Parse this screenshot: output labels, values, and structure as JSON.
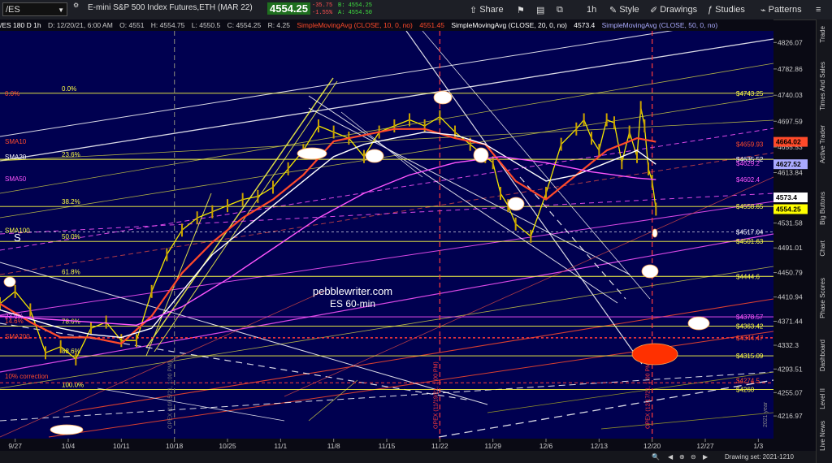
{
  "toolbar": {
    "symbol": "/ES",
    "title": "E-mini S&P 500 Index Futures,ETH (MAR 22)",
    "last_price": "4554.25",
    "change": "-35.75",
    "change_pct": "-1.55%",
    "bid": "B: 4554.25",
    "ask": "A: 4554.50",
    "share": "Share",
    "timeframe": "1h",
    "style": "Style",
    "drawings": "Drawings",
    "studies": "Studies",
    "patterns": "Patterns"
  },
  "info_bar": {
    "chart_id": "/ES 180 D 1h",
    "date": "D: 12/20/21, 6:00 AM",
    "open": "O: 4551",
    "high": "H: 4554.75",
    "low": "L: 4550.5",
    "close": "C: 4554.25",
    "range": "R: 4.25",
    "sma10": "SimpleMovingAvg (CLOSE, 10, 0, no)",
    "sma10_val": "4551.45",
    "sma20": "SimpleMovingAvg (CLOSE, 20, 0, no)",
    "sma20_val": "4573.4",
    "sma50": "SimpleMovingAvg (CLOSE, 50, 0, no)"
  },
  "sidebar": [
    "Trade",
    "Times And Sales",
    "Active Trader",
    "Big Buttons",
    "Chart",
    "Phase Scores",
    "Dashboard",
    "Level II",
    "Live News"
  ],
  "status": {
    "drawing_set": "Drawing set: 2021-1210"
  },
  "colors": {
    "background": "#000050",
    "sma10": "#ff4a2a",
    "sma20": "#ffffff",
    "sma50": "#ff55ff",
    "fib": "#ffff44",
    "opex": "#ff3a3a",
    "price_up": "#f2e600",
    "price_down": "#c8a000"
  },
  "chart_data": {
    "type": "line",
    "ylim": [
      4180,
      4845
    ],
    "y_ticks": [
      4826.07,
      4782.86,
      4740.03,
      4697.59,
      4655.53,
      4613.84,
      4572.6,
      4531.58,
      4491.01,
      4450.79,
      4410.94,
      4371.44,
      4332.3,
      4293.51,
      4255.07,
      4216.97
    ],
    "x_ticks": [
      "9/27",
      "10/4",
      "10/11",
      "10/18",
      "10/25",
      "11/1",
      "11/8",
      "11/15",
      "11/22",
      "11/29",
      "12/6",
      "12/13",
      "12/20",
      "12/27",
      "1/3"
    ],
    "x_tick_pos": [
      0,
      7,
      14,
      21,
      28,
      35,
      42,
      49,
      56,
      63,
      70,
      77,
      84,
      91,
      98
    ],
    "x_range": [
      -2,
      100
    ],
    "series": [
      {
        "name": "ES 60-min",
        "x": [
          -2,
          0,
          2,
          4,
          6,
          8,
          10,
          12,
          14,
          16,
          18,
          20,
          22,
          24,
          26,
          28,
          30,
          32,
          34,
          36,
          38,
          40,
          42,
          44,
          46,
          48,
          50,
          52,
          54,
          56,
          58,
          60,
          62,
          63,
          64,
          65,
          66,
          68,
          70,
          72,
          74,
          75,
          76,
          77,
          78,
          79,
          80,
          81,
          82,
          82.5,
          83,
          83.5,
          84,
          84.5
        ],
        "y": [
          4400,
          4420,
          4390,
          4320,
          4330,
          4310,
          4360,
          4370,
          4340,
          4340,
          4420,
          4480,
          4520,
          4540,
          4550,
          4560,
          4570,
          4575,
          4590,
          4620,
          4650,
          4690,
          4680,
          4670,
          4640,
          4680,
          4690,
          4700,
          4690,
          4705,
          4680,
          4660,
          4640,
          4630,
          4580,
          4560,
          4530,
          4510,
          4580,
          4660,
          4685,
          4700,
          4670,
          4650,
          4700,
          4695,
          4630,
          4680,
          4640,
          4720,
          4690,
          4620,
          4600,
          4554.25
        ]
      },
      {
        "name": "SMA10",
        "x": [
          -2,
          2,
          6,
          10,
          14,
          18,
          22,
          26,
          30,
          34,
          38,
          42,
          46,
          50,
          54,
          58,
          62,
          66,
          70,
          74,
          78,
          82,
          84.5
        ],
        "y": [
          4400,
          4370,
          4345,
          4345,
          4335,
          4380,
          4450,
          4500,
          4540,
          4570,
          4610,
          4665,
          4675,
          4685,
          4685,
          4670,
          4660,
          4600,
          4570,
          4610,
          4650,
          4670,
          4664.02
        ]
      },
      {
        "name": "SMA20",
        "x": [
          -2,
          2,
          6,
          10,
          14,
          18,
          22,
          26,
          30,
          34,
          38,
          42,
          46,
          50,
          54,
          58,
          62,
          66,
          70,
          74,
          78,
          82,
          84.5
        ],
        "y": [
          4390,
          4375,
          4360,
          4350,
          4345,
          4360,
          4420,
          4480,
          4520,
          4560,
          4600,
          4640,
          4660,
          4670,
          4680,
          4675,
          4660,
          4630,
          4600,
          4610,
          4630,
          4650,
          4627.52
        ]
      },
      {
        "name": "SMA50",
        "x": [
          -2,
          4,
          10,
          16,
          22,
          28,
          34,
          40,
          46,
          52,
          58,
          64,
          70,
          76,
          82,
          84.5
        ],
        "y": [
          4380,
          4375,
          4370,
          4365,
          4395,
          4440,
          4490,
          4540,
          4580,
          4610,
          4630,
          4640,
          4630,
          4615,
          4605,
          4602.4
        ]
      }
    ],
    "price_labels": [
      {
        "value": 4743.25,
        "text": "$4743.25",
        "color": "#ffff44"
      },
      {
        "value": 4659.93,
        "text": "$4659.93",
        "color": "#ff4a2a"
      },
      {
        "value": 4635.52,
        "text": "$4635.52",
        "color": "#ffffff"
      },
      {
        "value": 4629.2,
        "text": "$4629.2",
        "color": "#ff55ff"
      },
      {
        "value": 4602.4,
        "text": "$4602.4",
        "color": "#ff55ff"
      },
      {
        "value": 4558.65,
        "text": "$4558.65",
        "color": "#ffff44"
      },
      {
        "value": 4517.04,
        "text": "$4517.04",
        "color": "#ffffff"
      },
      {
        "value": 4501.63,
        "text": "$4501.63",
        "color": "#ffff44"
      },
      {
        "value": 4444.6,
        "text": "$4444.6",
        "color": "#ffff44"
      },
      {
        "value": 4378.57,
        "text": "$4378.57",
        "color": "#ff55ff"
      },
      {
        "value": 4363.42,
        "text": "$4363.42",
        "color": "#ffff44"
      },
      {
        "value": 4344.47,
        "text": "$4344.47",
        "color": "#ff4a2a"
      },
      {
        "value": 4315.09,
        "text": "$4315.09",
        "color": "#ffff44"
      },
      {
        "value": 4274.5,
        "text": "$4274.5",
        "color": "#ff4a2a"
      },
      {
        "value": 4260.0,
        "text": "$4260",
        "color": "#ffff44"
      }
    ],
    "current_markers": [
      {
        "value": 4664.02,
        "text": "4664.02",
        "bg": "#ff4a2a",
        "fg": "#000"
      },
      {
        "value": 4627.52,
        "text": "4627.52",
        "bg": "#aaaaff",
        "fg": "#000"
      },
      {
        "value": 4573.4,
        "text": "4573.4",
        "bg": "#ffffff",
        "fg": "#000"
      },
      {
        "value": 4554.25,
        "text": "4554.25",
        "bg": "#ffff00",
        "fg": "#000"
      }
    ],
    "fib_levels": [
      {
        "label": "0.0%",
        "value": 4743.25
      },
      {
        "label": "23.6%",
        "value": 4635.52
      },
      {
        "label": "38.2%",
        "value": 4558.65
      },
      {
        "label": "50.0%",
        "value": 4501.63
      },
      {
        "label": "61.8%",
        "value": 4444.6
      },
      {
        "label": "78.6%",
        "value": 4363.42
      },
      {
        "label": "88.6%",
        "value": 4315.09
      },
      {
        "label": "100.0%",
        "value": 4260.0
      }
    ],
    "left_labels": [
      {
        "label": "SMA10",
        "value": 4665,
        "color": "#ff4a2a"
      },
      {
        "label": "SMA20",
        "value": 4640,
        "color": "#ffffff"
      },
      {
        "label": "SMA50",
        "value": 4604,
        "color": "#ff55ff"
      },
      {
        "label": "SMA100",
        "value": 4520,
        "color": "#ffff44"
      },
      {
        "label": "SMA200",
        "value": 4347,
        "color": "#ff4a2a"
      },
      {
        "label": "23.6%",
        "value": 4380,
        "color": "#ff55ff"
      },
      {
        "label": "14.6%",
        "value": 4372,
        "color": "#ff4a2a"
      },
      {
        "label": "0.0%",
        "value": 4743.25,
        "color": "#ff4a2a"
      },
      {
        "label": "10% correction",
        "value": 4282,
        "color": "#ff4a2a"
      }
    ],
    "opex_lines": [
      {
        "x": 21,
        "label": "OPEX (10/15/21, 1:00 PM)",
        "color": "#777777"
      },
      {
        "x": 56,
        "label": "OPEX (11/19/21, 1:00 PM)",
        "color": "#ff3a3a"
      },
      {
        "x": 84,
        "label": "OPEX (12/17/21, 1:00 PM)",
        "color": "#ff3a3a"
      }
    ],
    "annotations": [
      "pebblewriter.com",
      "ES 60-min",
      "S",
      "2021 year"
    ],
    "grid": false,
    "legend": "top"
  }
}
